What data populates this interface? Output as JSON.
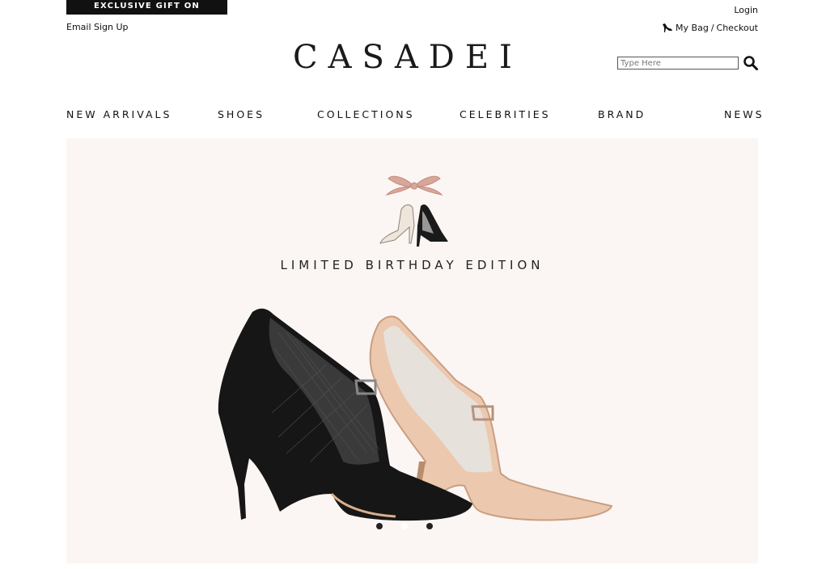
{
  "header": {
    "promo": "EXCLUSIVE GIFT ON PURCHASE",
    "email_signup": "Email Sign Up",
    "login": "Login",
    "bag": "My Bag",
    "separator": "/",
    "checkout": "Checkout",
    "logo": "CASADEI",
    "search_placeholder": "Type Here"
  },
  "nav": [
    "NEW ARRIVALS",
    "SHOES",
    "COLLECTIONS",
    "CELEBRITIES",
    "BRAND",
    "NEWS"
  ],
  "hero": {
    "title": "LIMITED BIRTHDAY EDITION",
    "slides": 3,
    "active_slide": 2,
    "background": "#fbf6f3"
  },
  "icons": {
    "bag": "high-heel-icon",
    "search": "magnifier-icon",
    "ribbon": "bow-icon"
  }
}
